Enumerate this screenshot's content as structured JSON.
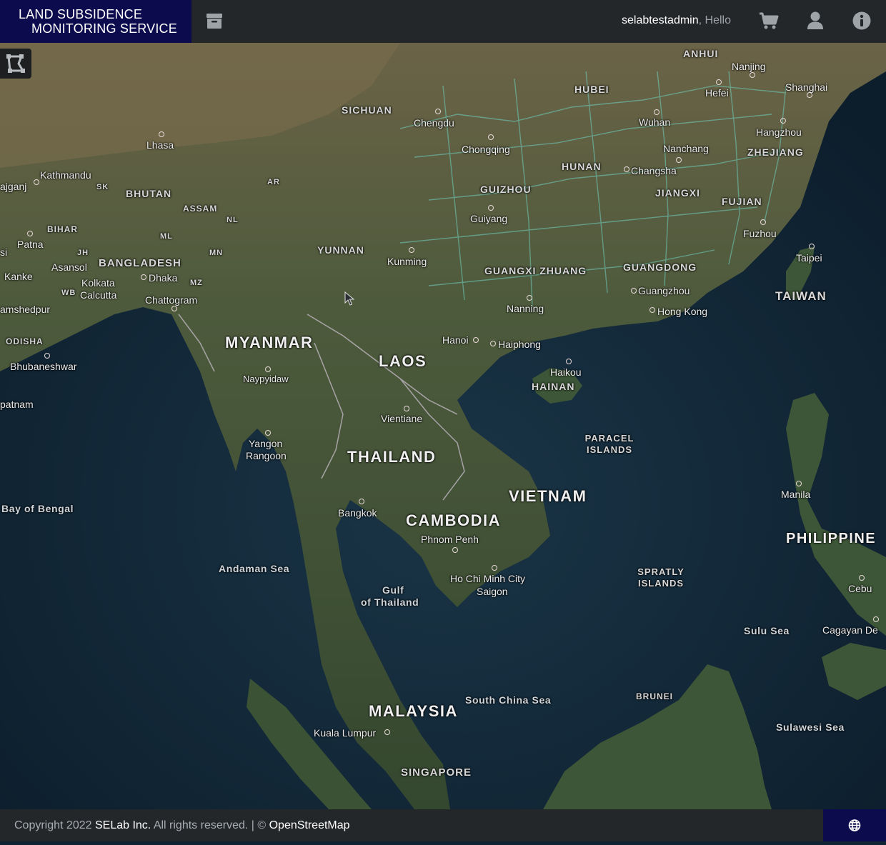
{
  "app": {
    "title_line1": "LAND SUBSIDENCE",
    "title_line2": "MONITORING SERVICE"
  },
  "header": {
    "username": "selabtestadmin",
    "greeting_suffix": ", Hello",
    "icons": [
      "archive-icon",
      "cart-icon",
      "user-icon",
      "info-icon"
    ]
  },
  "map": {
    "countries": [
      "MYANMAR",
      "LAOS",
      "THAILAND",
      "VIETNAM",
      "CAMBODIA",
      "MALAYSIA",
      "BANGLADESH",
      "BHUTAN",
      "TAIWAN",
      "PHILIPPINE",
      "SINGAPORE",
      "BRUNEI"
    ],
    "regions": [
      "SICHUAN",
      "HUBEI",
      "ANHUI",
      "HUNAN",
      "ZHEJIANG",
      "GUIZHOU",
      "JIANGXI",
      "FUJIAN",
      "YUNNAN",
      "GUANGXI ZHUANG",
      "GUANGDONG",
      "HAINAN",
      "ASSAM",
      "BIHAR",
      "ODISHA",
      "PARACEL ISLANDS",
      "SPRATLY ISLANDS",
      "AR",
      "NL",
      "ML",
      "MN",
      "MZ",
      "JH",
      "WB",
      "SK"
    ],
    "cities": [
      "Lhasa",
      "Kathmandu",
      "Chengdu",
      "Chongqing",
      "Wuhan",
      "Hefei",
      "Nanjing",
      "Shanghai",
      "Hangzhou",
      "Nanchang",
      "Changsha",
      "Guiyang",
      "Kunming",
      "Nanning",
      "Guangzhou",
      "Hong Kong",
      "Fuzhou",
      "Taipei",
      "Hanoi",
      "Haiphong",
      "Haikou",
      "Naypyidaw",
      "Yangon",
      "Rangoon",
      "Vientiane",
      "Bangkok",
      "Phnom Penh",
      "Ho Chi Minh City",
      "Saigon",
      "Kuala Lumpur",
      "Manila",
      "Cebu",
      "Cagayan De",
      "Patna",
      "Asansol",
      "Kolkata",
      "Calcutta",
      "Dhaka",
      "Chattogram",
      "Kanke",
      "amshedpur",
      "Bhubaneshwar",
      "patnam",
      "ajganj",
      "si"
    ],
    "seas": [
      "Bay of Bengal",
      "Andaman Sea",
      "Gulf",
      "of Thailand",
      "South China Sea",
      "Sulu Sea",
      "Sulawesi Sea"
    ],
    "toolbar": {
      "draw_tool_icon": "draw-polygon-icon"
    }
  },
  "footer": {
    "copyright_prefix": "Copyright 2022 ",
    "company": "SELab Inc.",
    "rights": " All rights reserved. | © ",
    "osm": "OpenStreetMap",
    "language_icon": "globe-icon"
  }
}
